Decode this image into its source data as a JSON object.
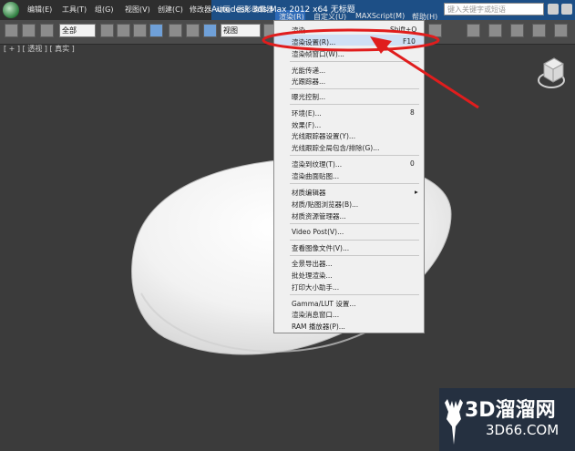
{
  "menubar": {
    "items": [
      "编辑(E)",
      "工具(T)",
      "组(G)",
      "视图(V)",
      "创建(C)",
      "修改器",
      "动画",
      "图形编辑器",
      "渲染(R)",
      "自定义(U)",
      "MAXScript(M)",
      "帮助(H)"
    ],
    "title": "Autodesk 3ds Max  2012 x64      无标题",
    "search_placeholder": "键入关键字或短语"
  },
  "toolbar": {
    "selection_filter": "全部",
    "view_dropdown": "视图"
  },
  "viewport": {
    "label": "[ + ] [ 透视 ] [ 真实 ]"
  },
  "render_menu": {
    "items": [
      {
        "label": "渲染",
        "shortcut": "Shift+Q"
      },
      {
        "label": "渲染设置(R)...",
        "shortcut": "F10"
      },
      {
        "label": "渲染帧窗口(W)...",
        "shortcut": ""
      },
      {
        "label": "光能传递...",
        "shortcut": ""
      },
      {
        "label": "光跟踪器...",
        "shortcut": ""
      },
      {
        "label": "曝光控制...",
        "shortcut": ""
      },
      {
        "label": "环境(E)...",
        "shortcut": "8"
      },
      {
        "label": "效果(F)...",
        "shortcut": ""
      },
      {
        "label": "光线跟踪器设置(Y)...",
        "shortcut": ""
      },
      {
        "label": "光线跟踪全局包含/排除(G)...",
        "shortcut": ""
      },
      {
        "label": "渲染到纹理(T)...",
        "shortcut": "0"
      },
      {
        "label": "渲染曲面贴图...",
        "shortcut": ""
      },
      {
        "label": "材质编辑器",
        "shortcut": "▸"
      },
      {
        "label": "材质/贴图浏览器(B)...",
        "shortcut": ""
      },
      {
        "label": "材质资源管理器...",
        "shortcut": ""
      },
      {
        "label": "Video Post(V)...",
        "shortcut": ""
      },
      {
        "label": "查看图像文件(V)...",
        "shortcut": ""
      },
      {
        "label": "全景导出器...",
        "shortcut": ""
      },
      {
        "label": "批处理渲染...",
        "shortcut": ""
      },
      {
        "label": "打印大小助手...",
        "shortcut": ""
      },
      {
        "label": "Gamma/LUT 设置...",
        "shortcut": ""
      },
      {
        "label": "渲染消息窗口...",
        "shortcut": ""
      },
      {
        "label": "RAM 播放器(P)...",
        "shortcut": ""
      }
    ]
  },
  "watermark": {
    "brand": "3D溜溜网",
    "url": "3D66.COM"
  },
  "colors": {
    "annotation_red": "#e01d1d",
    "menu_highlight": "#cfe0f5",
    "title_blue": "#1d4f86"
  }
}
